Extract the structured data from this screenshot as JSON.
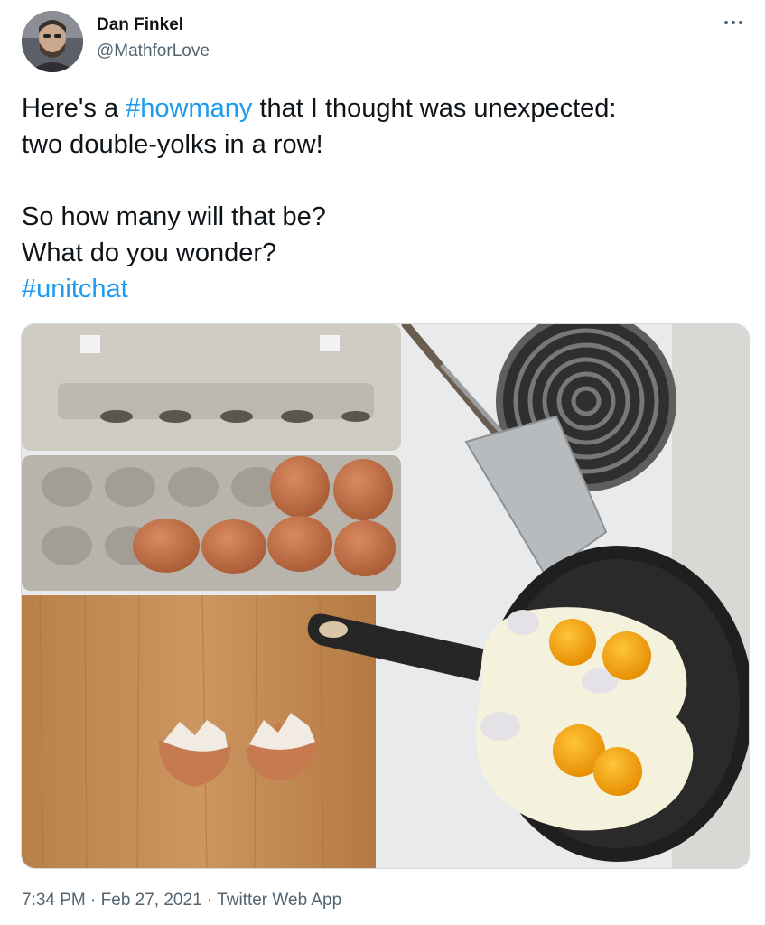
{
  "author": {
    "display_name": "Dan Finkel",
    "handle": "@MathforLove"
  },
  "tweet": {
    "line1_before": "Here's a ",
    "hashtag1": "#howmany",
    "line1_after": " that I thought was unexpected:",
    "line2": "two double-yolks in a row!",
    "line3": "So how many will that be?",
    "line4": "What do you wonder?",
    "hashtag2": "#unitchat"
  },
  "meta": {
    "time": "7:34 PM",
    "separator": " · ",
    "date": "Feb 27, 2021",
    "source": "Twitter Web App"
  },
  "photo": {
    "carton_eggs": 6,
    "cracked_shells": 2,
    "yolks_in_pan": 4
  },
  "colors": {
    "link": "#1d9bf0",
    "text": "#0f1419",
    "secondary": "#536471"
  },
  "icons": {
    "more": "more-icon"
  }
}
